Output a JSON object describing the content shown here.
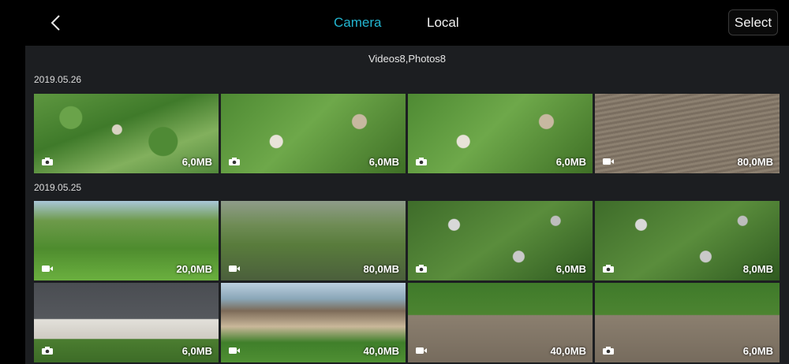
{
  "header": {
    "tabs": [
      {
        "label": "Camera",
        "active": true
      },
      {
        "label": "Local",
        "active": false
      }
    ],
    "select_label": "Select",
    "accent_color": "#23b6d1"
  },
  "summary": "Videos8,Photos8",
  "groups": [
    {
      "date": "2019.05.26",
      "items": [
        {
          "type": "photo",
          "size": "6,0MB"
        },
        {
          "type": "photo",
          "size": "6,0MB"
        },
        {
          "type": "photo",
          "size": "6,0MB"
        },
        {
          "type": "video",
          "size": "80,0MB"
        }
      ]
    },
    {
      "date": "2019.05.25",
      "items": [
        {
          "type": "video",
          "size": "20,0MB"
        },
        {
          "type": "video",
          "size": "80,0MB"
        },
        {
          "type": "photo",
          "size": "6,0MB"
        },
        {
          "type": "photo",
          "size": "8,0MB"
        },
        {
          "type": "photo",
          "size": "6,0MB"
        },
        {
          "type": "video",
          "size": "40,0MB"
        },
        {
          "type": "video",
          "size": "40,0MB"
        },
        {
          "type": "photo",
          "size": "6,0MB"
        }
      ]
    }
  ]
}
